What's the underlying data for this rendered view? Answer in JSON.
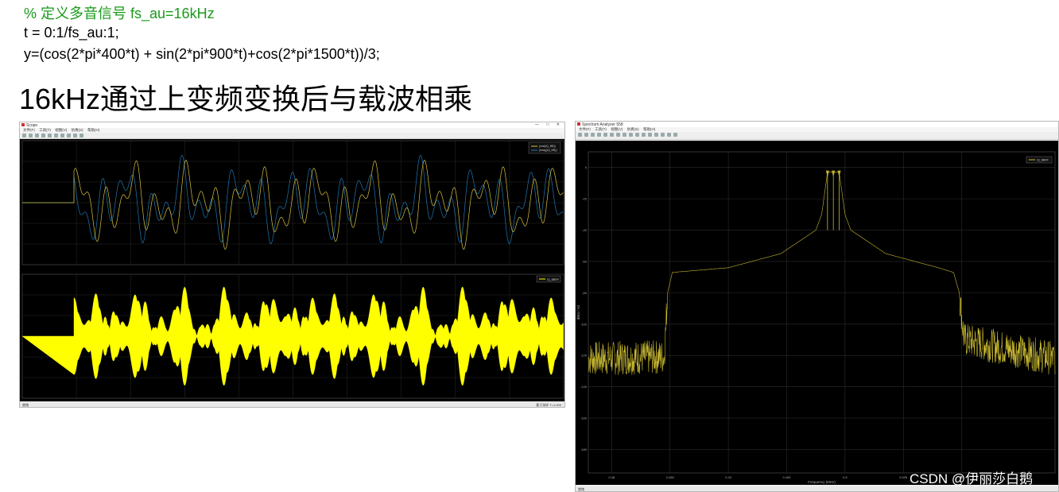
{
  "code": {
    "comment": "% 定义多音信号 fs_au=16kHz",
    "line1": "t = 0:1/fs_au:1;",
    "line2": "y=(cos(2*pi*400*t) + sin(2*pi*900*t)+cos(2*pi*1500*t))/3;"
  },
  "heading": "16kHz通过上变频变换后与载波相乘",
  "scope_window": {
    "title": "Scope",
    "menu": [
      "文件(F)",
      "工具(T)",
      "视图(V)",
      "仿真(S)",
      "帮助(H)"
    ],
    "legend_top": [
      "(real(IQ_BB))",
      "(imag(IQ_BB))"
    ],
    "legend_bottom": "IQ_BBRF",
    "status_left": "就绪",
    "status_right": "基于采样 T=1.000",
    "colors": {
      "real": "#d8c23a",
      "imag": "#1f77b4",
      "rf": "#ffff00",
      "bg": "#000000"
    }
  },
  "spectrum_window": {
    "title": "Spectrum Analyzer 558",
    "menu": [
      "文件(F)",
      "工具(T)",
      "视图(V)",
      "仿真(S)",
      "帮助(H)"
    ],
    "legend": "IQ_BBRF",
    "ylabel": "dBm / Hz",
    "xlabel": "Frequency (MHz)",
    "status_left": "就绪",
    "colors": {
      "trace": "#c8b830",
      "bg": "#000000"
    }
  },
  "chart_data": [
    {
      "type": "line",
      "title": "",
      "xlabel": "",
      "ylabel": "",
      "series": [
        {
          "name": "(real(IQ_BB))",
          "values": []
        },
        {
          "name": "(imag(IQ_BB))",
          "values": []
        }
      ],
      "grid": true,
      "legend": "top-right"
    },
    {
      "type": "area",
      "title": "",
      "series": [
        {
          "name": "IQ_BBRF",
          "values": []
        }
      ],
      "grid": true,
      "legend": "top-right"
    },
    {
      "type": "line",
      "title": "",
      "xlabel": "Frequency (MHz)",
      "ylabel": "dBm / Hz",
      "x_ticks": [
        "0.48",
        "0.485",
        "0.49",
        "0.495",
        "0.5",
        "0.505",
        "0.51"
      ],
      "y_ticks": [
        "0",
        "-20",
        "-40",
        "-60",
        "-80",
        "-100",
        "-120",
        "-140",
        "-160",
        "-180"
      ],
      "xlim": [
        0.478,
        0.518
      ],
      "ylim": [
        -195,
        10
      ],
      "series": [
        {
          "name": "IQ_BBRF",
          "points": [
            [
              0.478,
              -122
            ],
            [
              0.4845,
              -121
            ],
            [
              0.4848,
              -80
            ],
            [
              0.4852,
              -67
            ],
            [
              0.49,
              -64
            ],
            [
              0.4945,
              -55
            ],
            [
              0.4965,
              -45
            ],
            [
              0.4975,
              -40
            ],
            [
              0.498,
              -30
            ],
            [
              0.4985,
              -3
            ],
            [
              0.499,
              -3
            ],
            [
              0.4995,
              -3
            ],
            [
              0.5,
              -30
            ],
            [
              0.5005,
              -40
            ],
            [
              0.5015,
              -45
            ],
            [
              0.5035,
              -55
            ],
            [
              0.508,
              -64
            ],
            [
              0.5093,
              -67
            ],
            [
              0.5098,
              -80
            ],
            [
              0.5102,
              -110
            ],
            [
              0.518,
              -122
            ]
          ]
        }
      ],
      "grid": true,
      "legend": "top-right"
    }
  ]
}
